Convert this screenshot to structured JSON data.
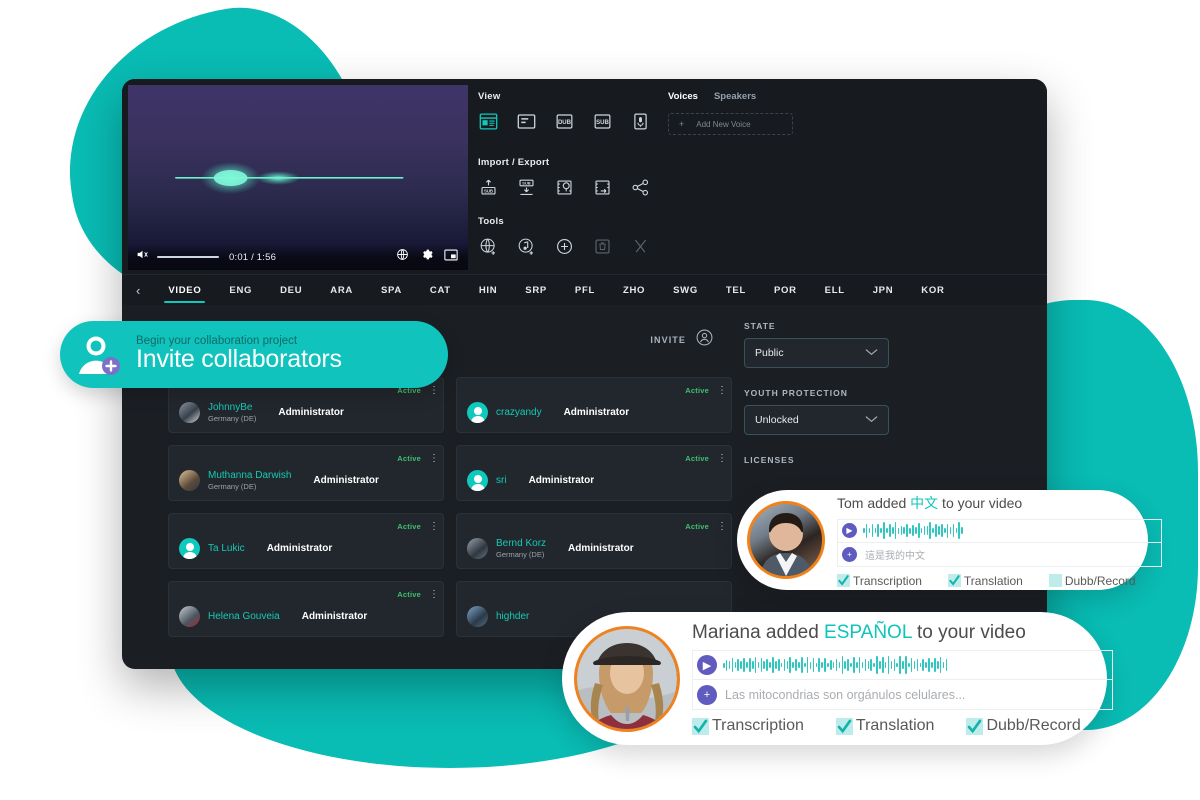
{
  "video": {
    "time_current": "0:01",
    "time_total": "1:56",
    "time_display": "0:01 / 1:56",
    "mute_icon": "speaker-muted-icon",
    "globe_icon": "globe-icon",
    "settings_icon": "gear-icon",
    "pip_icon": "picture-in-picture-icon"
  },
  "panel": {
    "view": {
      "title": "View",
      "icons": [
        {
          "name": "layout-view-icon",
          "label": "",
          "active": true
        },
        {
          "name": "list-view-icon",
          "label": "",
          "active": false
        },
        {
          "name": "dub-icon",
          "label": "DUB",
          "active": false
        },
        {
          "name": "sub-icon",
          "label": "SUB",
          "active": false
        },
        {
          "name": "microphone-icon",
          "label": "",
          "active": false
        }
      ]
    },
    "import_export": {
      "title": "Import / Export",
      "icons": [
        {
          "name": "import-subtitle-icon"
        },
        {
          "name": "export-subtitle-icon"
        },
        {
          "name": "import-media-icon"
        },
        {
          "name": "export-video-icon"
        },
        {
          "name": "share-icon"
        }
      ]
    },
    "tools": {
      "title": "Tools",
      "icons": [
        {
          "name": "add-language-icon",
          "disabled": false
        },
        {
          "name": "add-audio-icon",
          "disabled": false
        },
        {
          "name": "add-plus-icon",
          "disabled": false
        },
        {
          "name": "delete-trash-icon",
          "disabled": true
        },
        {
          "name": "cut-scissors-icon",
          "disabled": true
        }
      ]
    },
    "voices": {
      "tab_voices": "Voices",
      "tab_speakers": "Speakers",
      "add_new_voice": "Add New Voice",
      "plus": "+"
    }
  },
  "tabs": {
    "back_icon": "chevron-left-icon",
    "items": [
      {
        "label": "VIDEO",
        "active": true
      },
      {
        "label": "ENG",
        "active": false
      },
      {
        "label": "DEU",
        "active": false
      },
      {
        "label": "ARA",
        "active": false
      },
      {
        "label": "SPA",
        "active": false
      },
      {
        "label": "CAT",
        "active": false
      },
      {
        "label": "HIN",
        "active": false
      },
      {
        "label": "SRP",
        "active": false
      },
      {
        "label": "PFL",
        "active": false
      },
      {
        "label": "ZHO",
        "active": false
      },
      {
        "label": "SWG",
        "active": false
      },
      {
        "label": "TEL",
        "active": false
      },
      {
        "label": "POR",
        "active": false
      },
      {
        "label": "ELL",
        "active": false
      },
      {
        "label": "JPN",
        "active": false
      },
      {
        "label": "KOR",
        "active": false
      }
    ]
  },
  "invite": {
    "label": "INVITE",
    "icon": "invite-person-icon"
  },
  "collaborators": {
    "status_label": "Active",
    "column_left": [
      {
        "name": "JohnnyBe",
        "location": "Germany (DE)",
        "role": "Administrator",
        "status": "Active"
      },
      {
        "name": "Muthanna Darwish",
        "location": "Germany (DE)",
        "role": "Administrator",
        "status": "Active"
      },
      {
        "name": "Ta Lukic",
        "location": "",
        "role": "Administrator",
        "status": "Active"
      },
      {
        "name": "Helena Gouveia",
        "location": "",
        "role": "Administrator",
        "status": "Active"
      }
    ],
    "column_right": [
      {
        "name": "crazyandy",
        "location": "",
        "role": "Administrator",
        "status": "Active"
      },
      {
        "name": "sri",
        "location": "",
        "role": "Administrator",
        "status": "Active"
      },
      {
        "name": "Bernd Korz",
        "location": "Germany (DE)",
        "role": "Administrator",
        "status": "Active"
      },
      {
        "name": "highder",
        "location": "",
        "role": "",
        "status": ""
      }
    ]
  },
  "settings": {
    "state": {
      "label": "STATE",
      "value": "Public"
    },
    "youth_protection": {
      "label": "YOUTH PROTECTION",
      "value": "Unlocked"
    },
    "licenses": {
      "label": "LICENSES"
    }
  },
  "invite_pill": {
    "subtitle": "Begin your collaboration project",
    "title": "Invite collaborators",
    "icon": "add-person-icon"
  },
  "notifications": [
    {
      "id": "tom",
      "author": "Tom",
      "title_prefix": "Tom added ",
      "language": "中文",
      "title_suffix": " to your video",
      "transcript_text": "這是我的中文",
      "play_icon": "play-icon",
      "add_icon": "plus-icon",
      "checks": [
        {
          "label": "Transcription",
          "checked": true
        },
        {
          "label": "Translation",
          "checked": true
        },
        {
          "label": "Dubb/Record",
          "checked": false
        }
      ]
    },
    {
      "id": "mariana",
      "author": "Mariana",
      "title_prefix": "Mariana added ",
      "language": "ESPAÑOL",
      "title_suffix": " to your video",
      "transcript_text": "Las mitocondrias son orgánulos celulares...",
      "play_icon": "play-icon",
      "add_icon": "plus-icon",
      "checks": [
        {
          "label": "Transcription",
          "checked": true
        },
        {
          "label": "Translation",
          "checked": true
        },
        {
          "label": "Dubb/Record",
          "checked": true
        }
      ]
    }
  ],
  "colors": {
    "brand_teal": "#09bcb4",
    "accent_teal": "#0fc9bd",
    "app_bg": "#1b1f24",
    "panel_bg": "#171b20",
    "card_bg": "#22272d",
    "status_green": "#3fbf6e",
    "avatar_ring": "#f0821e",
    "username_teal": "#16c9b4"
  }
}
